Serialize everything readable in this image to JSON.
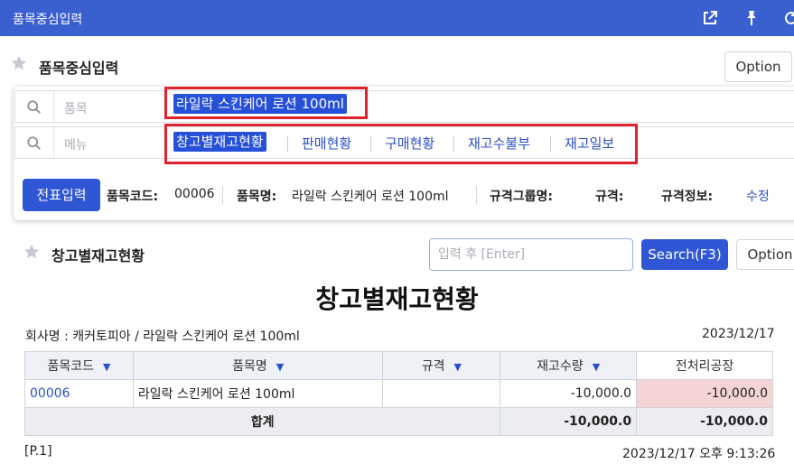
{
  "window": {
    "title": "품목중심입력"
  },
  "header": {
    "title": "품목중심입력",
    "option_label": "Option"
  },
  "search": {
    "item_placeholder": "품목",
    "item_value": "라일락 스킨케어 로션 100ml",
    "menu_placeholder": "메뉴",
    "menu_items": [
      "창고별재고현황",
      "판매현황",
      "구매현황",
      "재고수불부",
      "재고일보"
    ]
  },
  "item_info": {
    "slip_button": "전표입력",
    "code_label": "품목코드:",
    "code_value": "00006",
    "name_label": "품목명:",
    "name_value": "라일락 스킨케어 로션 100ml",
    "spec_group_label": "규격그룹명:",
    "spec_label": "규격:",
    "spec_info_label": "규격정보:",
    "edit_link": "수정"
  },
  "report": {
    "section_title": "창고별재고현황",
    "input_placeholder": "입력 후 [Enter]",
    "search_button": "Search(F3)",
    "option_label": "Option",
    "title": "창고별재고현황",
    "company_line": "회사명 : 캐커토피아 / 라일락 스킨케어 로션 100ml",
    "date": "2023/12/17",
    "columns": [
      "품목코드",
      "품목명",
      "규격",
      "재고수량",
      "전처리공장"
    ],
    "rows": [
      {
        "code": "00006",
        "name": "라일락 스킨케어 로션 100ml",
        "spec": "",
        "qty": "-10,000.0",
        "plant": "-10,000.0"
      }
    ],
    "total": {
      "label": "합계",
      "qty": "-10,000.0",
      "plant": "-10,000.0"
    },
    "page": "[P.1]",
    "printed_at": "2023/12/17 오후 9:13:26"
  },
  "colors": {
    "titlebar": "#3a5fcf",
    "primary": "#2f56d4",
    "link": "#2b4fc7",
    "highlight": "#e0232d",
    "negative_cell": "#f5d4d6"
  }
}
